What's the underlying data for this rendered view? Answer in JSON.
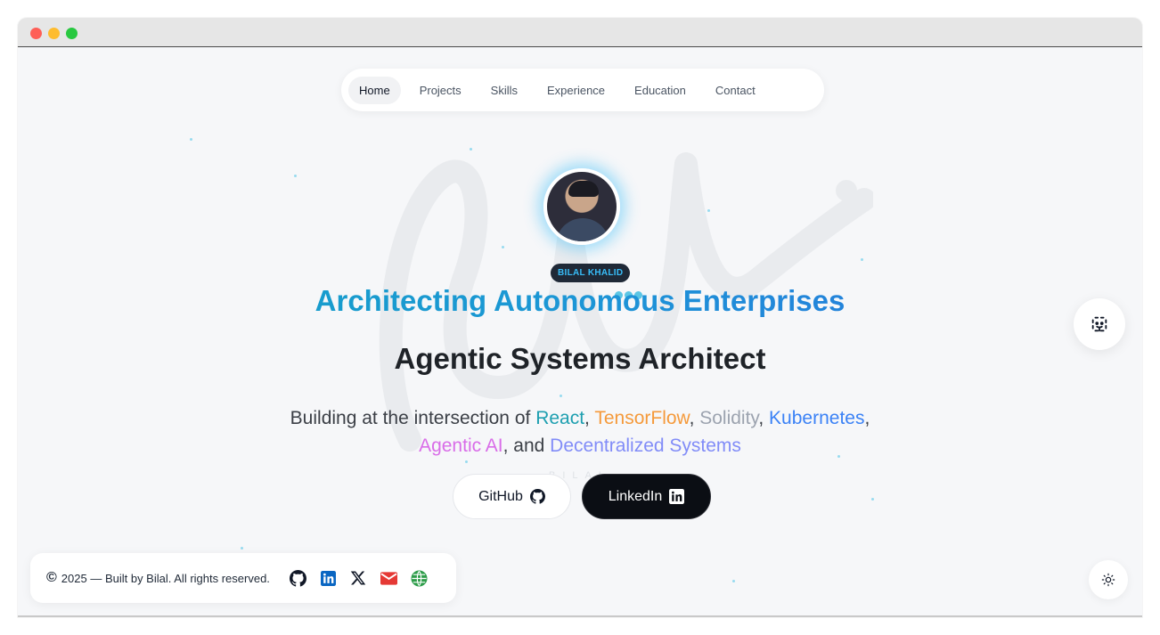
{
  "nav": {
    "items": [
      {
        "label": "Home"
      },
      {
        "label": "Projects"
      },
      {
        "label": "Skills"
      },
      {
        "label": "Experience"
      },
      {
        "label": "Education"
      },
      {
        "label": "Contact"
      }
    ],
    "active": "Home"
  },
  "profile": {
    "name_badge": "BILAL KHALID"
  },
  "hero": {
    "tagline": "Architecting Autonomous Enterprises",
    "headline": "Agentic Systems Architect",
    "sub_prefix": "Building at the intersection of ",
    "kw_react": "React",
    "sep1": ", ",
    "kw_tensorflow": "TensorFlow",
    "sep2": ", ",
    "kw_solidity": "Solidity",
    "sep3": ", ",
    "kw_kubernetes": "Kubernetes",
    "sep4": ",",
    "kw_agentic": "Agentic AI",
    "sep5": ", and ",
    "kw_decentralized": "Decentralized Systems",
    "faint_text": "BILAL"
  },
  "buttons": {
    "github": "GitHub",
    "linkedin": "LinkedIn"
  },
  "footer": {
    "copyright_symbol": "©",
    "text": "2025 — Built by Bilal. All rights reserved."
  },
  "icons": {
    "github": "github-icon",
    "linkedin": "linkedin-icon",
    "x": "x-icon",
    "email": "email-icon",
    "website": "globe-icon",
    "chat": "chatbot-icon",
    "theme": "sun-icon"
  },
  "colors": {
    "tagline_start": "#13a3c3",
    "tagline_end": "#2b6fe0",
    "react": "#1e9fb0",
    "tensorflow": "#f59a3b",
    "solidity": "#9ca3af",
    "kubernetes": "#3b82f6",
    "agentic_ai": "#d96de8",
    "decentralized": "#818cf8",
    "linkedin_blue": "#0a66c2",
    "email_red": "#e53935",
    "globe_green": "#2e9d4a"
  }
}
